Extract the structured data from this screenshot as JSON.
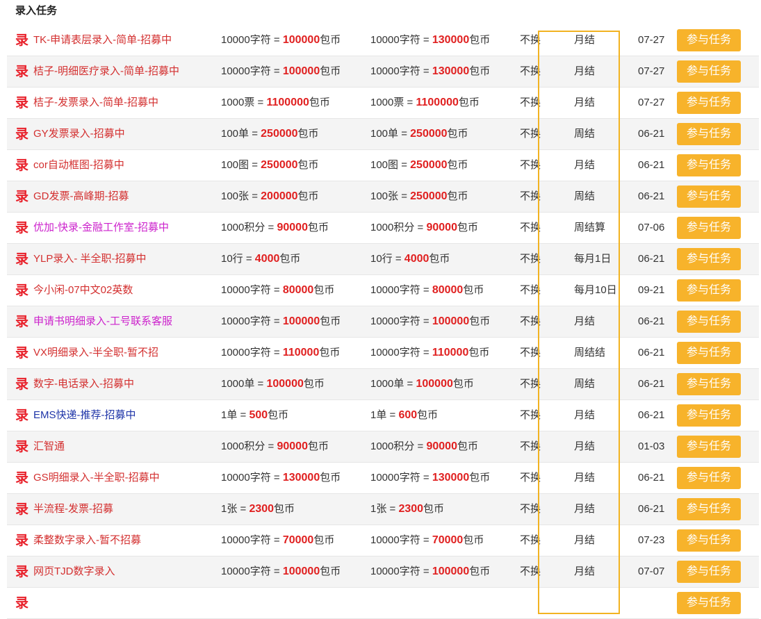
{
  "page": {
    "title": "录入任务"
  },
  "colors": {
    "name_red": "#d32f2f",
    "name_magenta": "#cc22cc",
    "name_blue": "#1f35a8",
    "rate_red": "#e02020",
    "button_orange": "#f7b32b",
    "highlight_box": "#f2b321"
  },
  "icon": {
    "glyph": "录",
    "semantic": "lu-record-icon"
  },
  "button_label": "参与任务",
  "tasks": [
    {
      "name": "TK-申请表层录入-简单-招募中",
      "color": "#d32f2f",
      "r1_unit": "10000字符",
      "r1_value": "100000",
      "r2_unit": "10000字符",
      "r2_value": "130000",
      "currency": "包币",
      "no_switch": "不换",
      "cycle": "月结",
      "date": "07-27"
    },
    {
      "name": "桔子-明细医疗录入-简单-招募中",
      "color": "#d32f2f",
      "r1_unit": "10000字符",
      "r1_value": "100000",
      "r2_unit": "10000字符",
      "r2_value": "130000",
      "currency": "包币",
      "no_switch": "不换",
      "cycle": "月结",
      "date": "07-27"
    },
    {
      "name": "桔子-发票录入-简单-招募中",
      "color": "#d32f2f",
      "r1_unit": "1000票",
      "r1_value": "1100000",
      "r2_unit": "1000票",
      "r2_value": "1100000",
      "currency": "包币",
      "no_switch": "不换",
      "cycle": "月结",
      "date": "07-27"
    },
    {
      "name": "GY发票录入-招募中",
      "color": "#d32f2f",
      "r1_unit": "100单",
      "r1_value": "250000",
      "r2_unit": "100单",
      "r2_value": "250000",
      "currency": "包币",
      "no_switch": "不换",
      "cycle": "周结",
      "date": "06-21"
    },
    {
      "name": "cor自动框图-招募中",
      "color": "#d32f2f",
      "r1_unit": "100图",
      "r1_value": "250000",
      "r2_unit": "100图",
      "r2_value": "250000",
      "currency": "包币",
      "no_switch": "不换",
      "cycle": "月结",
      "date": "06-21"
    },
    {
      "name": "GD发票-高峰期-招募",
      "color": "#d32f2f",
      "r1_unit": "100张",
      "r1_value": "200000",
      "r2_unit": "100张",
      "r2_value": "250000",
      "currency": "包币",
      "no_switch": "不换",
      "cycle": "周结",
      "date": "06-21"
    },
    {
      "name": "优加-快录-金融工作室-招募中",
      "color": "#cc22cc",
      "r1_unit": "1000积分",
      "r1_value": "90000",
      "r2_unit": "1000积分",
      "r2_value": "90000",
      "currency": "包币",
      "no_switch": "不换",
      "cycle": "周结算",
      "date": "07-06"
    },
    {
      "name": "YLP录入- 半全职-招募中",
      "color": "#d32f2f",
      "r1_unit": "10行",
      "r1_value": "4000",
      "r2_unit": "10行",
      "r2_value": "4000",
      "currency": "包币",
      "no_switch": "不换",
      "cycle": "每月1日",
      "date": "06-21"
    },
    {
      "name": "今小闲-07中文02英数",
      "color": "#d32f2f",
      "r1_unit": "10000字符",
      "r1_value": "80000",
      "r2_unit": "10000字符",
      "r2_value": "80000",
      "currency": "包币",
      "no_switch": "不换",
      "cycle": "每月10日",
      "date": "09-21"
    },
    {
      "name": "申请书明细录入-工号联系客服",
      "color": "#cc22cc",
      "r1_unit": "10000字符",
      "r1_value": "100000",
      "r2_unit": "10000字符",
      "r2_value": "100000",
      "currency": "包币",
      "no_switch": "不换",
      "cycle": "月结",
      "date": "06-21"
    },
    {
      "name": "VX明细录入-半全职-暂不招",
      "color": "#d32f2f",
      "r1_unit": "10000字符",
      "r1_value": "110000",
      "r2_unit": "10000字符",
      "r2_value": "110000",
      "currency": "包币",
      "no_switch": "不换",
      "cycle": "周结结",
      "date": "06-21"
    },
    {
      "name": "数字-电话录入-招募中",
      "color": "#d32f2f",
      "r1_unit": "1000单",
      "r1_value": "100000",
      "r2_unit": "1000单",
      "r2_value": "100000",
      "currency": "包币",
      "no_switch": "不换",
      "cycle": "周结",
      "date": "06-21"
    },
    {
      "name": "EMS快递-推荐-招募中",
      "color": "#1f35a8",
      "r1_unit": "1单",
      "r1_value": "500",
      "r2_unit": "1单",
      "r2_value": "600",
      "currency": "包币",
      "no_switch": "不换",
      "cycle": "月结",
      "date": "06-21"
    },
    {
      "name": "汇智通",
      "color": "#d32f2f",
      "r1_unit": "1000积分",
      "r1_value": "90000",
      "r2_unit": "1000积分",
      "r2_value": "90000",
      "currency": "包币",
      "no_switch": "不换",
      "cycle": "月结",
      "date": "01-03"
    },
    {
      "name": "GS明细录入-半全职-招募中",
      "color": "#d32f2f",
      "r1_unit": "10000字符",
      "r1_value": "130000",
      "r2_unit": "10000字符",
      "r2_value": "130000",
      "currency": "包币",
      "no_switch": "不换",
      "cycle": "月结",
      "date": "06-21"
    },
    {
      "name": "半流程-发票-招募",
      "color": "#d32f2f",
      "r1_unit": "1张",
      "r1_value": "2300",
      "r2_unit": "1张",
      "r2_value": "2300",
      "currency": "包币",
      "no_switch": "不换",
      "cycle": "月结",
      "date": "06-21"
    },
    {
      "name": "柔整数字录入-暂不招募",
      "color": "#d32f2f",
      "r1_unit": "10000字符",
      "r1_value": "70000",
      "r2_unit": "10000字符",
      "r2_value": "70000",
      "currency": "包币",
      "no_switch": "不换",
      "cycle": "月结",
      "date": "07-23"
    },
    {
      "name": "网页TJD数字录入",
      "color": "#d32f2f",
      "r1_unit": "10000字符",
      "r1_value": "100000",
      "r2_unit": "10000字符",
      "r2_value": "100000",
      "currency": "包币",
      "no_switch": "不换",
      "cycle": "月结",
      "date": "07-07"
    },
    {
      "name": "",
      "color": "#d32f2f",
      "r1_unit": "",
      "r1_value": "",
      "r2_unit": "",
      "r2_value": "",
      "currency": "",
      "no_switch": "",
      "cycle": "",
      "date": ""
    }
  ]
}
